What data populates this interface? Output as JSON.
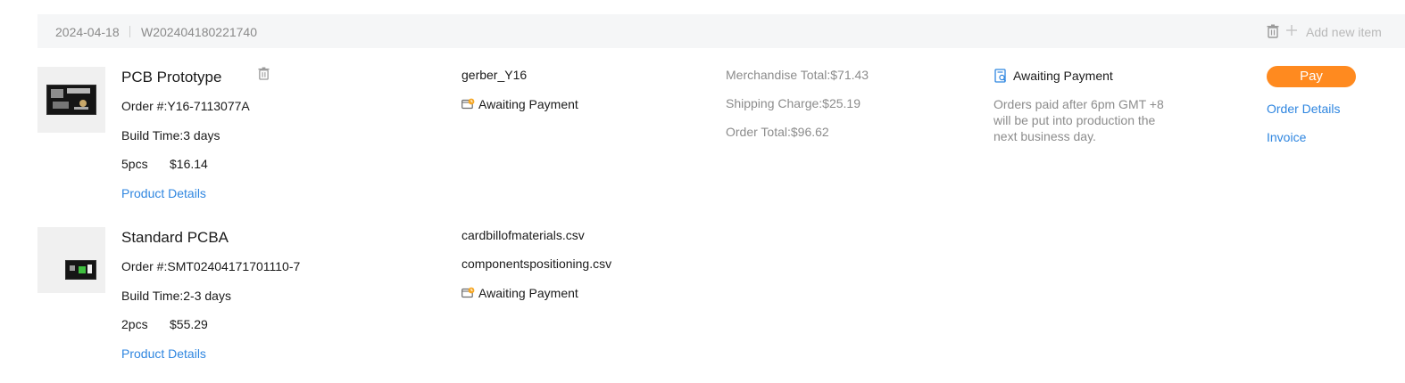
{
  "header": {
    "date": "2024-04-18",
    "order_group_no": "W202404180221740",
    "add_item_label": "Add new item"
  },
  "items": [
    {
      "title": "PCB Prototype",
      "order_no": "Order #:Y16-7113077A",
      "build_time": "Build Time:3 days",
      "qty": "5pcs",
      "price": "$16.14",
      "details_link": "Product Details",
      "files": [
        "gerber_Y16"
      ],
      "status": "Awaiting Payment"
    },
    {
      "title": "Standard PCBA",
      "order_no": "Order #:SMT02404171701110-7",
      "build_time": "Build Time:2-3 days",
      "qty": "2pcs",
      "price": "$55.29",
      "details_link": "Product Details",
      "files": [
        "cardbillofmaterials.csv",
        "componentspositioning.csv"
      ],
      "status": "Awaiting Payment"
    }
  ],
  "totals": {
    "merchandise": "Merchandise Total:$71.43",
    "shipping": "Shipping Charge:$25.19",
    "order_total": "Order Total:$96.62"
  },
  "payment": {
    "status": "Awaiting Payment",
    "note": "Orders paid after 6pm GMT +8 will be put into production the next business day."
  },
  "actions": {
    "pay_label": "Pay",
    "order_details_label": "Order Details",
    "invoice_label": "Invoice"
  },
  "colors": {
    "accent_link": "#2f86e0",
    "pay_button": "#ff8a1f",
    "header_bg": "#f5f6f7"
  }
}
